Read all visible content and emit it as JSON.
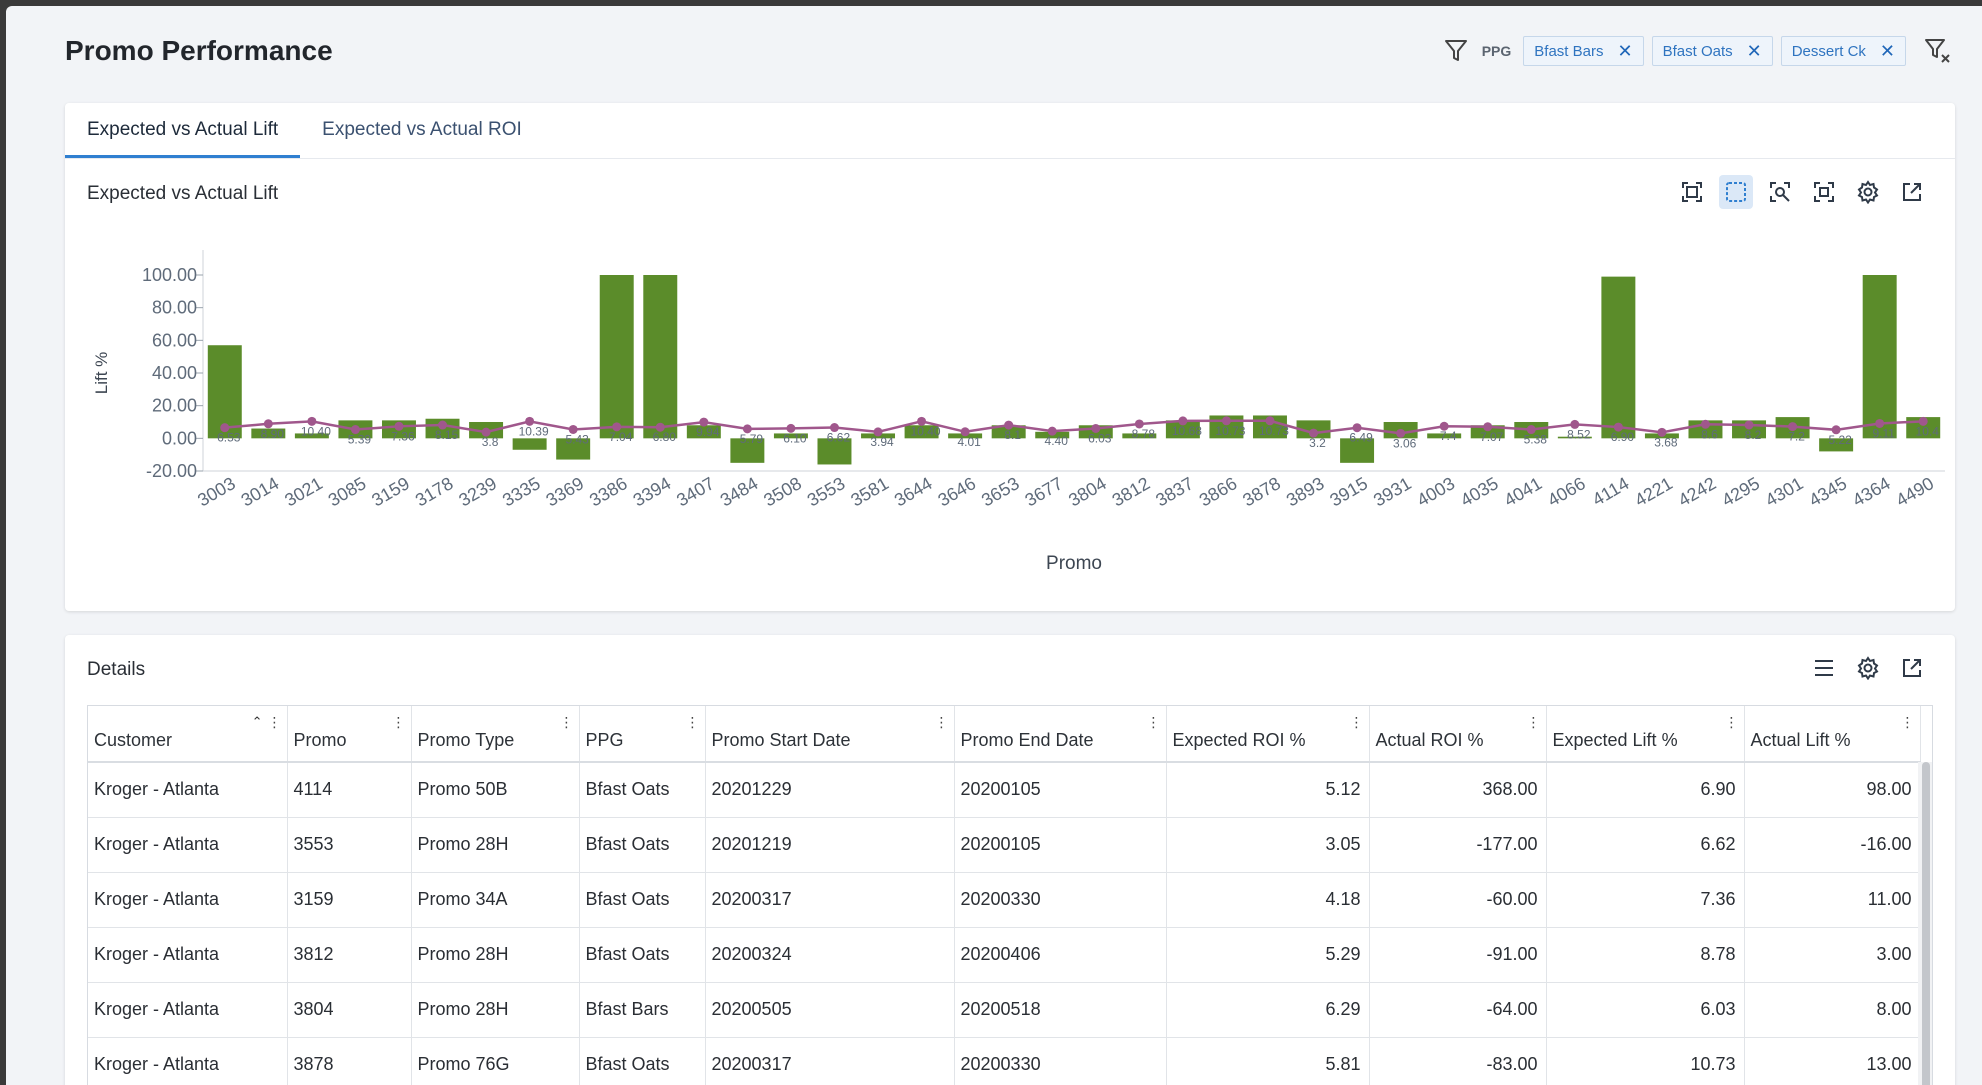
{
  "page": {
    "title": "Promo Performance"
  },
  "filters": {
    "ppg_label": "PPG",
    "chips": [
      {
        "label": "Bfast Bars"
      },
      {
        "label": "Bfast Oats"
      },
      {
        "label": "Dessert Ck"
      }
    ]
  },
  "tabs": [
    {
      "label": "Expected vs Actual Lift",
      "active": true
    },
    {
      "label": "Expected vs Actual ROI",
      "active": false
    }
  ],
  "chart_card": {
    "title": "Expected vs Actual Lift"
  },
  "chart_data": {
    "type": "bar",
    "xlabel": "Promo",
    "ylabel": "Lift %",
    "ylim": [
      -20,
      100
    ],
    "yticks": [
      "100.00",
      "80.00",
      "60.00",
      "40.00",
      "20.00",
      "0.00",
      "-20.00"
    ],
    "categories": [
      "3003",
      "3014",
      "3021",
      "3085",
      "3159",
      "3178",
      "3239",
      "3335",
      "3369",
      "3386",
      "3394",
      "3407",
      "3484",
      "3508",
      "3553",
      "3581",
      "3644",
      "3646",
      "3653",
      "3677",
      "3804",
      "3812",
      "3837",
      "3866",
      "3878",
      "3893",
      "3915",
      "3931",
      "4003",
      "4035",
      "4041",
      "4066",
      "4114",
      "4221",
      "4242",
      "4295",
      "4301",
      "4345",
      "4364",
      "4490"
    ],
    "series": [
      {
        "kind": "bar",
        "color": "#5b8c2a",
        "values": [
          57,
          6,
          3,
          11,
          11,
          12,
          10,
          -7,
          -13,
          100,
          100,
          8,
          -15,
          3,
          -16,
          3,
          8,
          3,
          8,
          4,
          8,
          3,
          11,
          14,
          14,
          11,
          -15,
          10,
          3,
          8,
          10,
          1,
          99,
          3,
          11,
          11,
          13,
          -8,
          100,
          13
        ]
      },
      {
        "kind": "line",
        "color": "#a0578c",
        "values": [
          6.53,
          8.9,
          10.4,
          5.39,
          7.36,
          8.15,
          3.8,
          10.39,
          5.43,
          7.04,
          6.8,
          9.94,
          5.79,
          6.1,
          6.62,
          3.94,
          10.4,
          4.01,
          8.1,
          4.4,
          6.03,
          8.78,
          10.68,
          10.73,
          10.73,
          3.2,
          6.49,
          3.06,
          7.4,
          7.07,
          5.38,
          8.52,
          6.9,
          3.68,
          8.6,
          8.2,
          7.2,
          5.22,
          9.11,
          10.4
        ]
      }
    ],
    "point_labels": [
      "6.53",
      "8.90",
      "10.40",
      "5.39",
      "7.36",
      "8.15",
      "3.8",
      "10.39",
      "5.43",
      "7.04",
      "6.80",
      "9.94",
      "5.79",
      "6.10",
      "6.62",
      "3.94",
      "10.40",
      "4.01",
      "8.1",
      "4.40",
      "6.03",
      "8.78",
      "10.68",
      "10.73",
      "10.73",
      "3.2",
      "6.49",
      "3.06",
      "7.4",
      "7.07",
      "5.38",
      "8.52",
      "6.90",
      "3.68",
      "8.6",
      "8.2",
      "7.2",
      "5.22",
      "9.11",
      "10.4"
    ]
  },
  "details": {
    "title": "Details",
    "columns": [
      "Customer",
      "Promo",
      "Promo Type",
      "PPG",
      "Promo Start Date",
      "Promo End Date",
      "Expected ROI %",
      "Actual ROI %",
      "Expected Lift %",
      "Actual Lift %"
    ],
    "rows": [
      [
        "Kroger - Atlanta",
        "4114",
        "Promo 50B",
        "Bfast Oats",
        "20201229",
        "20200105",
        "5.12",
        "368.00",
        "6.90",
        "98.00"
      ],
      [
        "Kroger - Atlanta",
        "3553",
        "Promo 28H",
        "Bfast Oats",
        "20201219",
        "20200105",
        "3.05",
        "-177.00",
        "6.62",
        "-16.00"
      ],
      [
        "Kroger - Atlanta",
        "3159",
        "Promo 34A",
        "Bfast Oats",
        "20200317",
        "20200330",
        "4.18",
        "-60.00",
        "7.36",
        "11.00"
      ],
      [
        "Kroger - Atlanta",
        "3812",
        "Promo 28H",
        "Bfast Oats",
        "20200324",
        "20200406",
        "5.29",
        "-91.00",
        "8.78",
        "3.00"
      ],
      [
        "Kroger - Atlanta",
        "3804",
        "Promo 28H",
        "Bfast Bars",
        "20200505",
        "20200518",
        "6.29",
        "-64.00",
        "6.03",
        "8.00"
      ],
      [
        "Kroger - Atlanta",
        "3878",
        "Promo 76G",
        "Bfast Oats",
        "20200317",
        "20200330",
        "5.81",
        "-83.00",
        "10.73",
        "13.00"
      ]
    ]
  }
}
